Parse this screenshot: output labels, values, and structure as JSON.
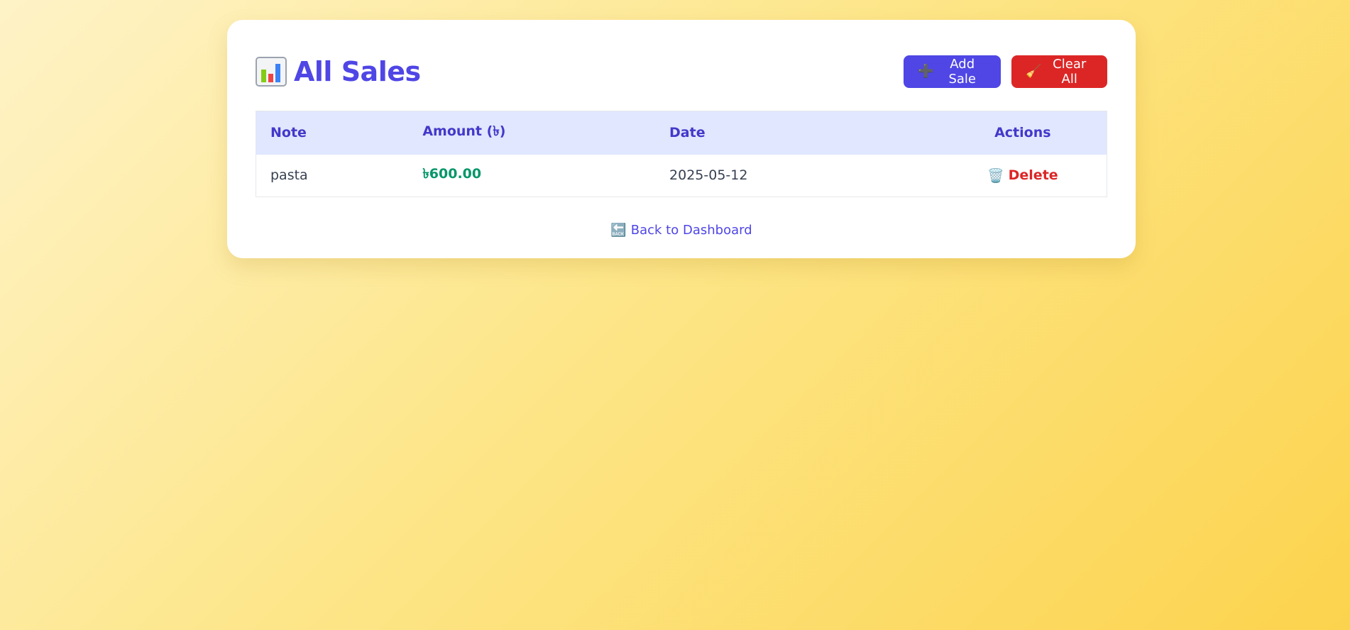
{
  "page": {
    "title": "All Sales",
    "title_icon": "bar-chart-icon"
  },
  "toolbar": {
    "add_label": "Add Sale",
    "add_icon": "➕",
    "clear_label": "Clear All",
    "clear_icon": "🧹"
  },
  "table": {
    "columns": [
      "Note",
      "Amount (৳)",
      "Date",
      "Actions"
    ],
    "rows": [
      {
        "note": "pasta",
        "amount": "৳600.00",
        "date": "2025-05-12",
        "action_label": "Delete",
        "action_icon": "🗑️"
      }
    ]
  },
  "footer": {
    "back_label": "Back to Dashboard",
    "back_icon": "🔙"
  },
  "colors": {
    "accent": "#4f46e5",
    "danger": "#dc2626",
    "amount": "#059669",
    "header_bg": "#e0e7ff"
  }
}
